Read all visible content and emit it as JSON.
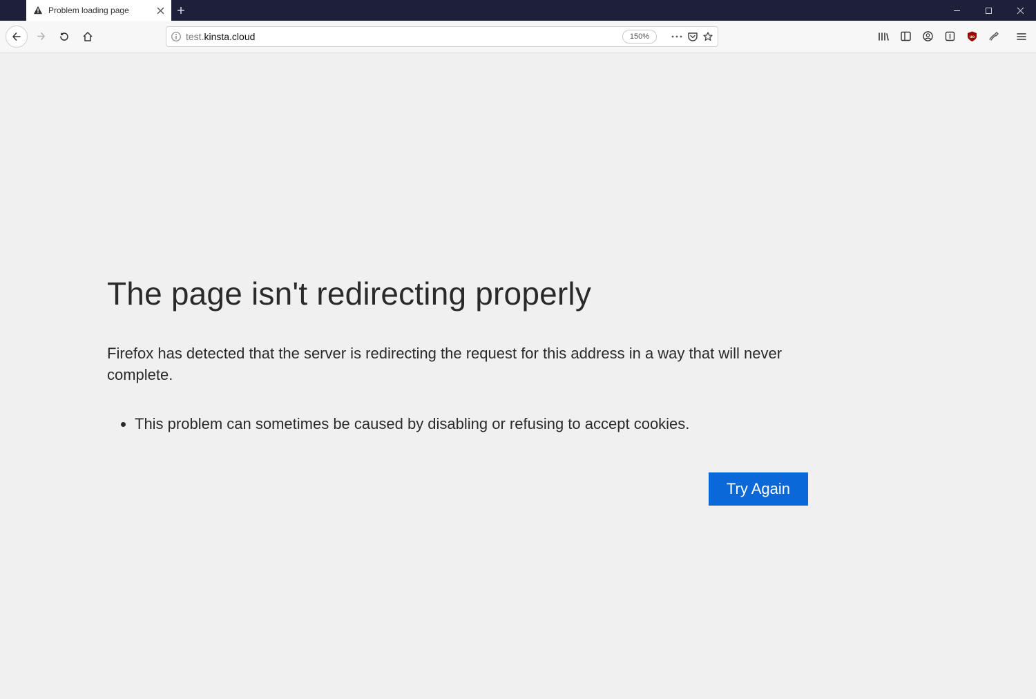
{
  "tab": {
    "title": "Problem loading page"
  },
  "toolbar": {
    "url_prefix": "test.",
    "url_host": "kinsta.cloud",
    "zoom": "150%"
  },
  "error": {
    "title": "The page isn't redirecting properly",
    "description": "Firefox has detected that the server is redirecting the request for this address in a way that will never complete.",
    "bullet": "This problem can sometimes be caused by disabling or refusing to accept cookies.",
    "try_again": "Try Again"
  }
}
